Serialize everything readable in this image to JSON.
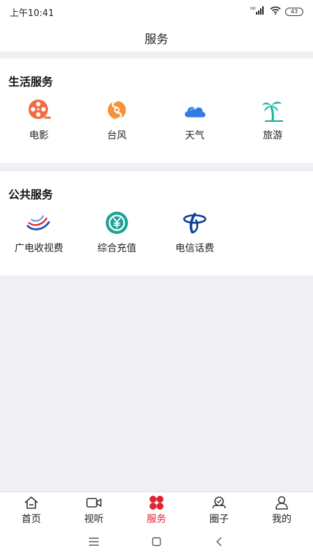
{
  "status": {
    "time": "上午10:41",
    "hd": "HD",
    "battery": "43"
  },
  "header": {
    "title": "服务"
  },
  "sections": [
    {
      "title": "生活服务",
      "items": [
        {
          "label": "电影",
          "icon": "film-reel-icon",
          "color": "#f26a3f"
        },
        {
          "label": "台风",
          "icon": "typhoon-icon",
          "color": "#f7923a"
        },
        {
          "label": "天气",
          "icon": "cloud-icon",
          "color": "#2f7de1"
        },
        {
          "label": "旅游",
          "icon": "palm-tree-icon",
          "color": "#14b39a"
        }
      ]
    },
    {
      "title": "公共服务",
      "items": [
        {
          "label": "广电收视费",
          "icon": "broadcast-logo-icon"
        },
        {
          "label": "综合充值",
          "icon": "recharge-yuan-icon",
          "color": "#1aa394"
        },
        {
          "label": "电信话费",
          "icon": "china-telecom-logo-icon",
          "color": "#0b3f9a"
        }
      ]
    }
  ],
  "tabbar": {
    "items": [
      {
        "label": "首页",
        "icon": "home-icon"
      },
      {
        "label": "视听",
        "icon": "video-camera-icon"
      },
      {
        "label": "服务",
        "icon": "services-grid-icon",
        "active": true
      },
      {
        "label": "圈子",
        "icon": "community-icon"
      },
      {
        "label": "我的",
        "icon": "profile-icon"
      }
    ],
    "active_color": "#e0242f"
  }
}
